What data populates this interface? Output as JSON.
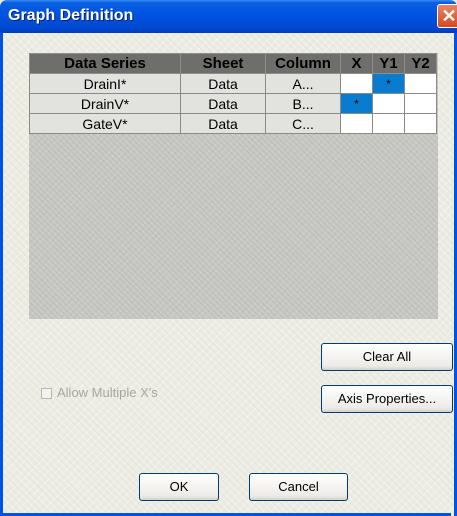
{
  "window": {
    "title": "Graph Definition",
    "close_glyph": "✕"
  },
  "table": {
    "headers": [
      "Data Series",
      "Sheet",
      "Column",
      "X",
      "Y1",
      "Y2"
    ],
    "rows": [
      {
        "series": "DrainI*",
        "sheet": "Data",
        "column": "A...",
        "x": "",
        "y1": "*",
        "y2": ""
      },
      {
        "series": "DrainV*",
        "sheet": "Data",
        "column": "B...",
        "x": "*",
        "y1": "",
        "y2": ""
      },
      {
        "series": "GateV*",
        "sheet": "Data",
        "column": "C...",
        "x": "",
        "y1": "",
        "y2": ""
      }
    ]
  },
  "buttons": {
    "clear_all": "Clear All",
    "axis_properties": "Axis Properties...",
    "ok": "OK",
    "cancel": "Cancel"
  },
  "options": {
    "allow_multiple_x_label": "Allow Multiple X's",
    "allow_multiple_x_checked": false
  },
  "colors": {
    "selected_cell": "#0A7CD0",
    "titlebar": "#0054E3"
  }
}
